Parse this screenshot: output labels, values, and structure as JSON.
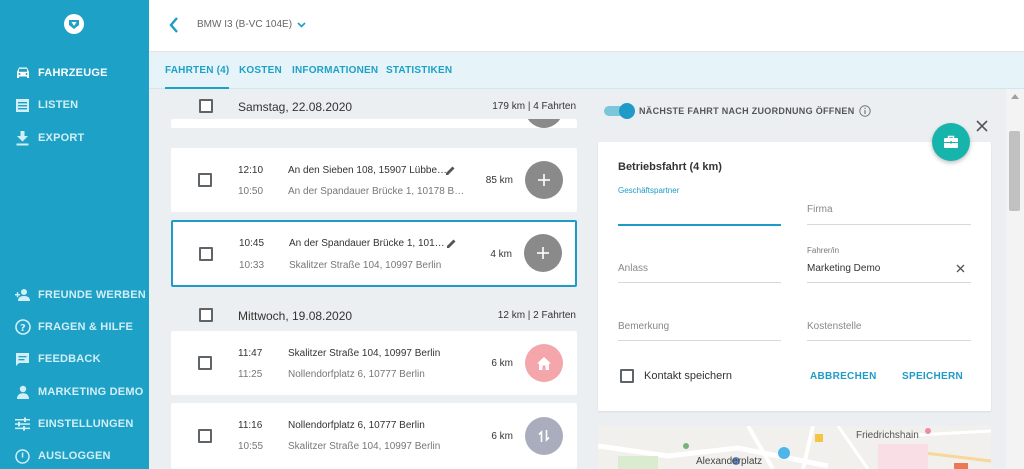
{
  "sidebar": {
    "items": [
      {
        "label": "FAHRZEUGE",
        "icon": "car-icon"
      },
      {
        "label": "LISTEN",
        "icon": "list-icon"
      },
      {
        "label": "EXPORT",
        "icon": "download-icon"
      }
    ],
    "bottom_items": [
      {
        "label": "FREUNDE WERBEN",
        "icon": "add-user-icon"
      },
      {
        "label": "FRAGEN & HILFE",
        "icon": "help-icon"
      },
      {
        "label": "FEEDBACK",
        "icon": "feedback-icon"
      },
      {
        "label": "MARKETING DEMO",
        "icon": "person-icon"
      },
      {
        "label": "EINSTELLUNGEN",
        "icon": "settings-icon"
      },
      {
        "label": "AUSLOGGEN",
        "icon": "power-icon"
      }
    ]
  },
  "header": {
    "vehicle": "BMW I3 (B-VC 104E)"
  },
  "tabs": [
    {
      "label": "FAHRTEN (4)",
      "active": true
    },
    {
      "label": "KOSTEN"
    },
    {
      "label": "INFORMATIONEN"
    },
    {
      "label": "STATISTIKEN"
    }
  ],
  "days": [
    {
      "date": "Samstag, 22.08.2020",
      "summary": "179 km  |  4 Fahrten"
    },
    {
      "date": "Mittwoch, 19.08.2020",
      "summary": "12 km  |  2 Fahrten"
    }
  ],
  "trips": [
    {
      "start_time": "12:10",
      "end_time": "10:50",
      "to": "An den Sieben 108, 15907 Lübbe…",
      "from": "An der Spandauer Brücke 1, 10178 B…",
      "km": "85 km",
      "action": "plus",
      "color": "#8a8a8a"
    },
    {
      "start_time": "10:45",
      "end_time": "10:33",
      "to": "An der Spandauer Brücke 1, 101…",
      "from": "Skalitzer Straße 104, 10997 Berlin",
      "km": "4 km",
      "action": "plus",
      "color": "#8a8a8a"
    },
    {
      "start_time": "11:47",
      "end_time": "11:25",
      "to": "Skalitzer Straße 104, 10997 Berlin",
      "from": "Nollendorfplatz 6, 10777 Berlin",
      "km": "6 km",
      "action": "home",
      "color": "#f4a6aa"
    },
    {
      "start_time": "11:16",
      "end_time": "10:55",
      "to": "Nollendorfplatz 6, 10777 Berlin",
      "from": "Skalitzer Straße 104, 10997 Berlin",
      "km": "6 km",
      "action": "swap",
      "color": "#a9adbd"
    }
  ],
  "panel": {
    "toggle_label": "NÄCHSTE FAHRT NACH ZUORDNUNG ÖFFNEN",
    "title": "Betriebsfahrt (4 km)",
    "fields": {
      "partner_label": "Geschäftspartner",
      "company_ph": "Firma",
      "driver_label": "Fahrer/in",
      "driver_value": "Marketing Demo",
      "reason_ph": "Anlass",
      "remark_ph": "Bemerkung",
      "costcenter_ph": "Kostenstelle"
    },
    "save_contact": "Kontakt speichern",
    "cancel": "ABBRECHEN",
    "save": "SPEICHERN"
  },
  "map": {
    "labels": [
      "Friedrichshain",
      "Alexanderplatz"
    ]
  },
  "colors": {
    "sidebar": "#1ea1c6",
    "accent": "#1e9bc8",
    "fab": "#16b4ab"
  }
}
